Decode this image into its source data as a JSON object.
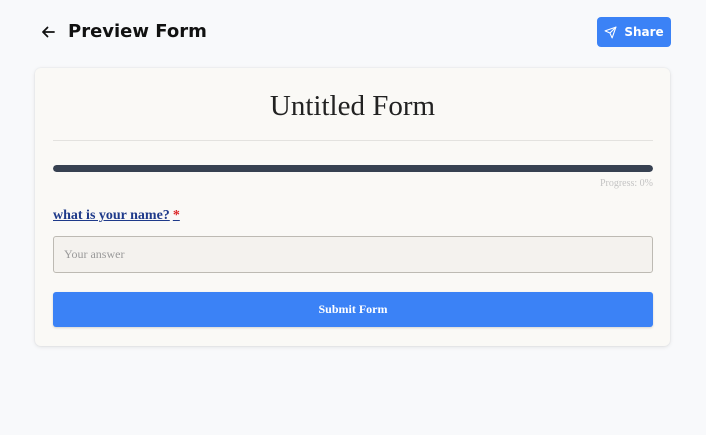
{
  "header": {
    "title": "Preview Form",
    "share_label": "Share",
    "back_icon": "arrow-left-icon",
    "share_icon": "send-icon"
  },
  "form": {
    "title": "Untitled Form",
    "progress": {
      "percent": 0,
      "label": "Progress: 0%"
    },
    "question": {
      "label": "what is your name?",
      "required_mark": "*"
    },
    "answer": {
      "placeholder": "Your answer",
      "value": ""
    },
    "submit_label": "Submit Form"
  },
  "colors": {
    "accent": "#3b82f6",
    "progress_fill": "#374151",
    "question_text": "#1e3a8a",
    "required": "#dc2626"
  }
}
